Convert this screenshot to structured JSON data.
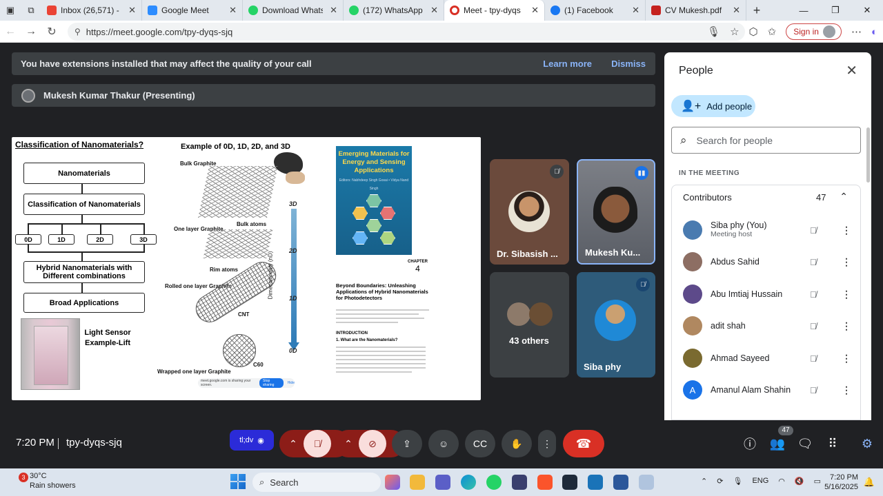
{
  "browser": {
    "tabs": [
      {
        "title": "Inbox (26,571) - sdpd",
        "color": "#ea4335"
      },
      {
        "title": "Google Meet",
        "color": "#2d8cff"
      },
      {
        "title": "Download WhatsApp",
        "color": "#25d366"
      },
      {
        "title": "(172) WhatsApp",
        "color": "#25d366"
      },
      {
        "title": "Meet - tpy-dyqs",
        "color": "#d93025"
      },
      {
        "title": "(1) Facebook",
        "color": "#1877f2"
      },
      {
        "title": "CV Mukesh.pdf",
        "color": "#c5221f"
      }
    ],
    "url": "https://meet.google.com/tpy-dyqs-sjq",
    "signin_label": "Sign in"
  },
  "banner": {
    "text": "You have extensions installed that may affect the quality of your call",
    "learn_more": "Learn more",
    "dismiss": "Dismiss"
  },
  "presenter": {
    "label": "Mukesh Kumar Thakur (Presenting)"
  },
  "slide": {
    "title": "Classification of Nanomaterials?",
    "flow": {
      "nanomaterials": "Nanomaterials",
      "classification": "Classification of Nanomaterials",
      "d0": "0D",
      "d1": "1D",
      "d2": "2D",
      "d3": "3D",
      "hybrid": "Hybrid Nanomaterials with Different combinations",
      "broad": "Broad Applications"
    },
    "lift_text": "Light Sensor Example-Lift",
    "example_title": "Example of 0D, 1D, 2D, and 3D",
    "labels": {
      "bulk_graphite": "Bulk Graphite",
      "one_layer": "One layer Graphite",
      "bulk_atoms": "Bulk atoms",
      "rim_atoms": "Rim atoms",
      "rolled": "Rolled one layer Graphite",
      "cnt": "CNT",
      "c60": "C60",
      "wrapped": "Wrapped one layer Graphite"
    },
    "dims": {
      "d3": "3D",
      "d2": "2D",
      "d1": "1D",
      "d0": "0D",
      "axis": "Dimensionality (nD)"
    },
    "share_bar": {
      "text": "meet.google.com is sharing your screen.",
      "stop": "Stop sharing",
      "hide": "Hide"
    },
    "book": {
      "title": "Emerging Materials for Energy and Sensing Applications",
      "authors": "Editors: Nabhdeep Singh Gosai • Vidya Nand Singh"
    },
    "chapter": {
      "label": "CHAPTER",
      "num": "4"
    },
    "paper_title": "Beyond Boundaries: Unleashing Applications of Hybrid Nanomaterials for Photodetectors",
    "intro": "INTRODUCTION",
    "intro_sub": "1. What are the Nanomaterials?"
  },
  "participants": [
    {
      "name": "Dr. Sibasish ...",
      "muted": true
    },
    {
      "name": "Mukesh Ku...",
      "speaking": true
    },
    {
      "name": "43 others"
    },
    {
      "name": "Siba phy",
      "muted": true
    }
  ],
  "people_panel": {
    "title": "People",
    "add_people": "Add people",
    "search_placeholder": "Search for people",
    "in_meeting": "IN THE MEETING",
    "contributors_label": "Contributors",
    "contributors_count": "47",
    "list": [
      {
        "name": "Siba phy (You)",
        "sub": "Meeting host",
        "color": "#4a7bb0"
      },
      {
        "name": "Abdus Sahid",
        "sub": "",
        "color": "#8d6e63"
      },
      {
        "name": "Abu Imtiaj Hussain",
        "sub": "",
        "color": "#5d4a8a"
      },
      {
        "name": "adit shah",
        "sub": "",
        "color": "#b08860"
      },
      {
        "name": "Ahmad Sayeed",
        "sub": "",
        "color": "#7a6a30"
      },
      {
        "name": "Amanul Alam Shahin",
        "sub": "",
        "color": "#1a73e8",
        "initial": "A"
      }
    ]
  },
  "bottom_bar": {
    "time": "7:20 PM",
    "meeting_code": "tpy-dyqs-sjq",
    "present_chip": "tl;dv",
    "people_badge": "47"
  },
  "taskbar": {
    "weather_temp": "30°C",
    "weather_desc": "Rain showers",
    "weather_badge": "3",
    "search": "Search",
    "lang": "ENG",
    "clock_time": "7:20 PM",
    "clock_date": "5/16/2025"
  }
}
